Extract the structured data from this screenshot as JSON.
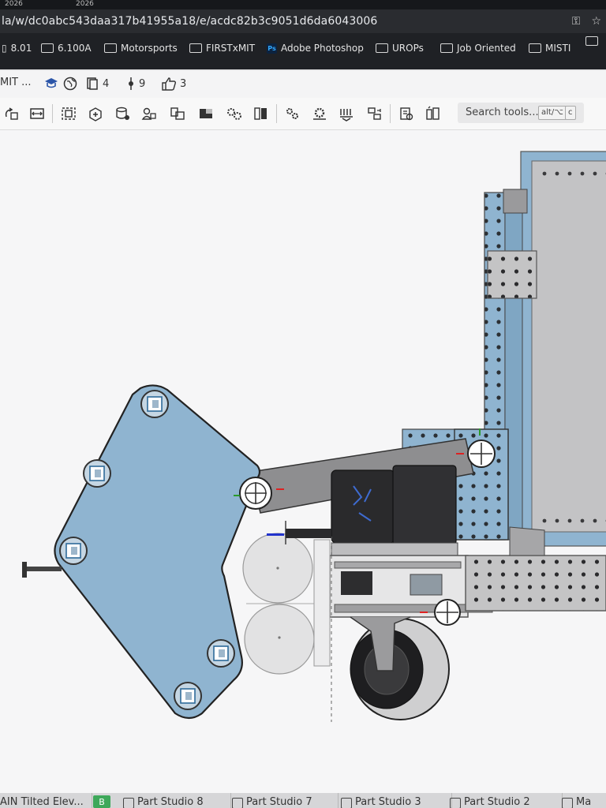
{
  "browser": {
    "tabs": [
      "2026",
      "2026"
    ],
    "url": "la/w/dc0abc543daa317b41955a18/e/acdc82b3c9051d6da6043006",
    "bookmarks": [
      {
        "label": "8.01",
        "icon": "page-icon"
      },
      {
        "label": "6.100A",
        "icon": "folder-icon"
      },
      {
        "label": "Motorsports",
        "icon": "folder-icon"
      },
      {
        "label": "FIRSTxMIT",
        "icon": "folder-icon"
      },
      {
        "label": "Adobe Photoshop",
        "icon": "photoshop-icon"
      },
      {
        "label": "UROPs",
        "icon": "folder-icon"
      },
      {
        "label": "Job Oriented",
        "icon": "folder-icon"
      },
      {
        "label": "MISTI",
        "icon": "folder-icon"
      }
    ]
  },
  "doc_header": {
    "title": "MIT ...",
    "versions_count": "4",
    "branches_count": "9",
    "likes_count": "3"
  },
  "toolbar": {
    "search_placeholder": "Search tools...",
    "shortcut_1": "alt/⌥",
    "shortcut_2": "c"
  },
  "bottom_tabs": [
    {
      "label": "AIN Tilted Elev..."
    },
    {
      "label": "Part Studio 8"
    },
    {
      "label": "Part Studio 7"
    },
    {
      "label": "Part Studio 3"
    },
    {
      "label": "Part Studio 2"
    },
    {
      "label": "Ma"
    }
  ],
  "colors": {
    "part_blue": "#8fb4d0",
    "steel_grey": "#a9a9a9",
    "dark_part": "#2a2a2c"
  }
}
